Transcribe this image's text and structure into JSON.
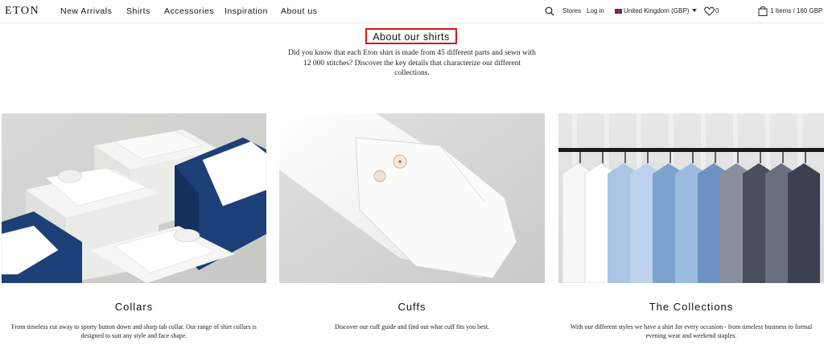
{
  "header": {
    "logo": "ETON",
    "nav": [
      "New Arrivals",
      "Shirts",
      "Accessories",
      "Inspiration",
      "About us"
    ],
    "stores": "Stores",
    "login": "Log in",
    "region": "United Kingdom (GBP)",
    "wishlist_count": "0",
    "cart": "1 Items / 160 GBP"
  },
  "page": {
    "title": "About our shirts",
    "intro": "Did you know that each Eton shirt is made from 45 different parts and sewn with 12 000 stitches? Discover the key details that characterize our different collections."
  },
  "cards": [
    {
      "title": "Collars",
      "description": "From timeless cut away to sporty button down and sharp tab collar. Our range of shirt collars is designed to suit any style and face shape."
    },
    {
      "title": "Cuffs",
      "description": "Discover our cuff guide and find out what cuff fits you best."
    },
    {
      "title": "The Collections",
      "description": "With our different styles we have a shirt for every occasion - from timeless business to formal evening wear and weekend staples."
    }
  ],
  "colors": {
    "highlight_border": "#d01a1a",
    "box_blue": "#1c3f78"
  }
}
